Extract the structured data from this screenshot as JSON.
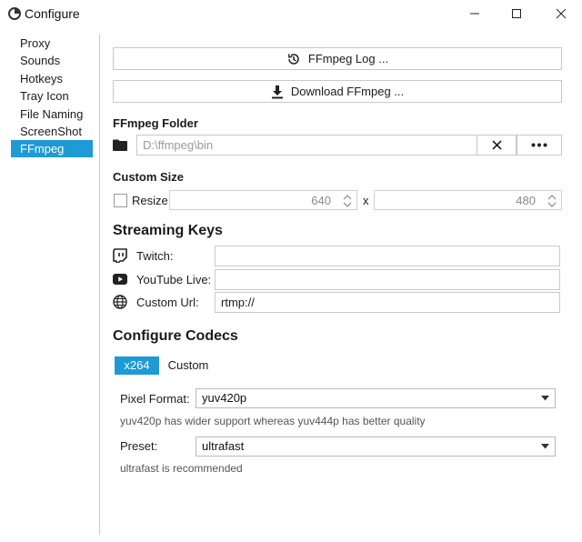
{
  "window": {
    "title": "Configure"
  },
  "sidebar": {
    "items": [
      {
        "label": "Proxy"
      },
      {
        "label": "Sounds"
      },
      {
        "label": "Hotkeys"
      },
      {
        "label": "Tray Icon"
      },
      {
        "label": "File Naming"
      },
      {
        "label": "ScreenShot"
      },
      {
        "label": "FFmpeg"
      }
    ],
    "active": "FFmpeg"
  },
  "ffmpeg": {
    "log_button": "FFmpeg Log ...",
    "download_button": "Download FFmpeg ...",
    "folder_label": "FFmpeg Folder",
    "folder_placeholder": "D:\\ffmpeg\\bin"
  },
  "custom_size": {
    "label": "Custom Size",
    "resize_label": "Resize",
    "resize_checked": false,
    "width": "640",
    "separator": "x",
    "height": "480"
  },
  "streaming_keys": {
    "heading": "Streaming Keys",
    "twitch_label": "Twitch:",
    "twitch_value": "",
    "youtube_label": "YouTube Live:",
    "youtube_value": "",
    "custom_url_label": "Custom Url:",
    "custom_url_value": "rtmp://"
  },
  "codecs": {
    "heading": "Configure Codecs",
    "tabs": [
      {
        "label": "x264"
      },
      {
        "label": "Custom"
      }
    ],
    "active_tab": "x264",
    "pixel_format_label": "Pixel Format:",
    "pixel_format_value": "yuv420p",
    "pixel_format_hint": "yuv420p has wider support whereas yuv444p has better quality",
    "preset_label": "Preset:",
    "preset_value": "ultrafast",
    "preset_hint": "ultrafast is recommended"
  },
  "colors": {
    "accent": "#1e9ad6",
    "border": "#c9c9c9",
    "divider": "#c8c8c8"
  },
  "icons": {
    "app": "app-icon",
    "minimize": "minimize-icon",
    "maximize": "maximize-icon",
    "close": "close-icon",
    "log": "history-icon",
    "download": "download-icon",
    "folder": "folder-icon",
    "clear": "clear-icon",
    "browse": "more-icon",
    "twitch": "twitch-icon",
    "youtube": "youtube-icon",
    "globe": "globe-icon",
    "dropdown": "chevron-down-icon"
  }
}
